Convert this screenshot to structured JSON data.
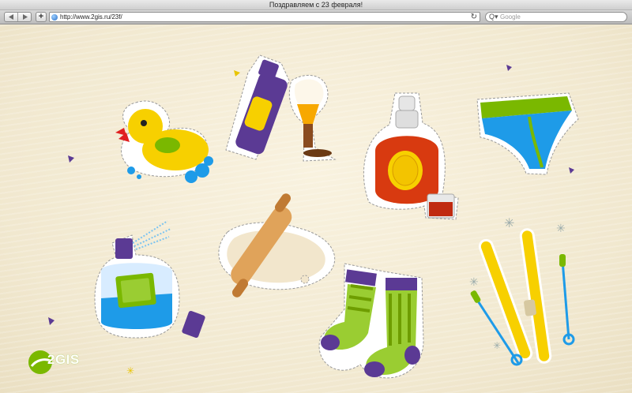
{
  "window": {
    "title": "Поздравляем с 23 февраля!"
  },
  "toolbar": {
    "back_icon": "back-arrow-icon",
    "forward_icon": "forward-arrow-icon",
    "add_label": "+",
    "url": "http://www.2gis.ru/23f/",
    "reload_glyph": "↻",
    "search_placeholder": "Google",
    "search_glyph": "Q▾"
  },
  "page": {
    "logo_text": "2GIS",
    "accent_green": "#7ab800",
    "background": "#f3ecd7",
    "stickers": [
      "rubber-duck",
      "spray-can",
      "shaving-brush",
      "liquor-bottle",
      "underpants",
      "cologne-bottle",
      "rolling-pin",
      "socks",
      "skis"
    ]
  }
}
